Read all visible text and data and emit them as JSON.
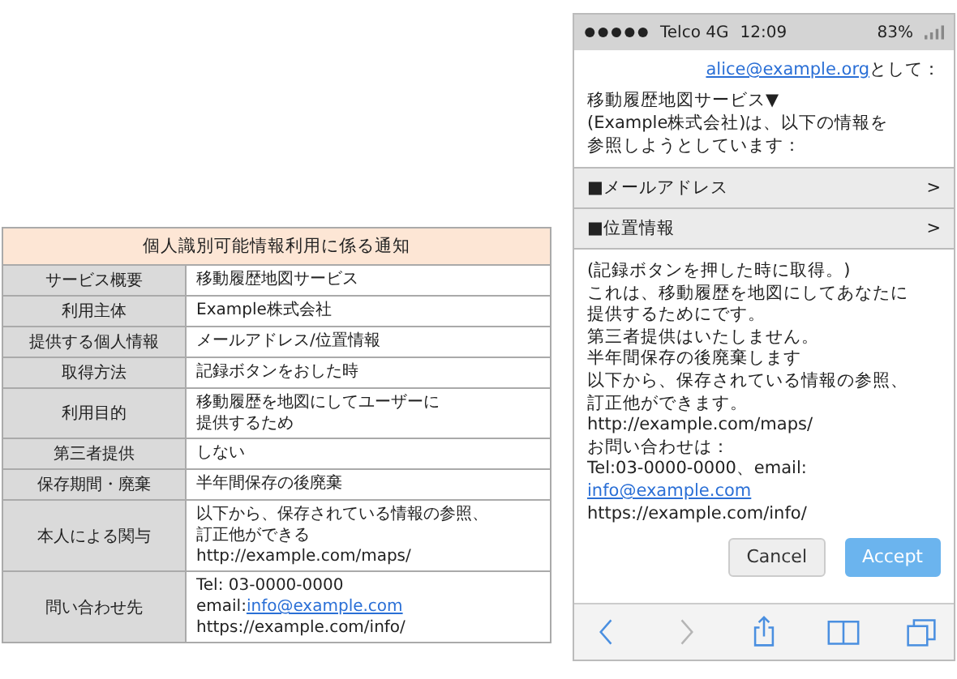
{
  "notice_table": {
    "title": "個人識別可能情報利用に係る通知",
    "rows": [
      {
        "label": "サービス概要",
        "lines": [
          [
            {
              "text": "移動履歴地図サービス",
              "link": false
            }
          ]
        ]
      },
      {
        "label": "利用主体",
        "lines": [
          [
            {
              "text": "Example株式会社",
              "link": false
            }
          ]
        ]
      },
      {
        "label": "提供する個人情報",
        "lines": [
          [
            {
              "text": "メールアドレス/位置情報",
              "link": false
            }
          ]
        ]
      },
      {
        "label": "取得方法",
        "lines": [
          [
            {
              "text": "記録ボタンをおした時",
              "link": false
            }
          ]
        ]
      },
      {
        "label": "利用目的",
        "lines": [
          [
            {
              "text": "移動履歴を地図にしてユーザーに",
              "link": false
            }
          ],
          [
            {
              "text": "提供するため",
              "link": false
            }
          ]
        ]
      },
      {
        "label": "第三者提供",
        "lines": [
          [
            {
              "text": "しない",
              "link": false
            }
          ]
        ]
      },
      {
        "label": "保存期間・廃棄",
        "lines": [
          [
            {
              "text": "半年間保存の後廃棄",
              "link": false
            }
          ]
        ]
      },
      {
        "label": "本人による関与",
        "lines": [
          [
            {
              "text": "以下から、保存されている情報の参照、",
              "link": false
            }
          ],
          [
            {
              "text": "訂正他ができる",
              "link": false
            }
          ],
          [
            {
              "text": "http://example.com/maps/",
              "link": false
            }
          ]
        ]
      },
      {
        "label": "問い合わせ先",
        "lines": [
          [
            {
              "text": "Tel: 03-0000-0000",
              "link": false
            }
          ],
          [
            {
              "text": "email:",
              "link": false
            },
            {
              "text": "info@example.com",
              "link": true
            }
          ],
          [
            {
              "text": "https://example.com/info/",
              "link": false
            }
          ]
        ]
      }
    ]
  },
  "phone": {
    "status_bar": {
      "carrier": "Telco 4G",
      "time": "12:09",
      "battery": "83%"
    },
    "account_line": [
      {
        "text": "alice@example.org",
        "link": true
      },
      {
        "text": "として：",
        "link": false
      }
    ],
    "intro_lines": [
      "移動履歴地図サービス▼",
      "(Example株式会社)は、以下の情報を",
      "参照しようとしています："
    ],
    "sections": [
      {
        "label": "■メールアドレス",
        "chevron": ">"
      },
      {
        "label": "■位置情報",
        "chevron": ">"
      }
    ],
    "detail_lines": [
      [
        {
          "text": "(記録ボタンを押した時に取得。)",
          "link": false
        }
      ],
      [
        {
          "text": "これは、移動履歴を地図にしてあなたに",
          "link": false
        }
      ],
      [
        {
          "text": "提供するためにです。",
          "link": false
        }
      ],
      [
        {
          "text": "第三者提供はいたしません。",
          "link": false
        }
      ],
      [
        {
          "text": "半年間保存の後廃棄します",
          "link": false
        }
      ],
      [
        {
          "text": "以下から、保存されている情報の参照、",
          "link": false
        }
      ],
      [
        {
          "text": "訂正他ができます。",
          "link": false
        }
      ],
      [
        {
          "text": "http://example.com/maps/",
          "link": false
        }
      ],
      [
        {
          "text": "お問い合わせは：",
          "link": false
        }
      ],
      [
        {
          "text": "Tel:03-0000-0000、email:",
          "link": false
        }
      ],
      [
        {
          "text": "info@example.com",
          "link": true
        }
      ],
      [
        {
          "text": "https://example.com/info/",
          "link": false
        }
      ]
    ],
    "buttons": [
      {
        "label": "Cancel",
        "kind": "secondary"
      },
      {
        "label": "Accept",
        "kind": "primary"
      }
    ],
    "toolbar": [
      {
        "kind": "back",
        "disabled": false
      },
      {
        "kind": "forward",
        "disabled": true
      },
      {
        "kind": "share",
        "disabled": false
      },
      {
        "kind": "bookmarks",
        "disabled": false
      },
      {
        "kind": "tabs",
        "disabled": false
      }
    ]
  }
}
